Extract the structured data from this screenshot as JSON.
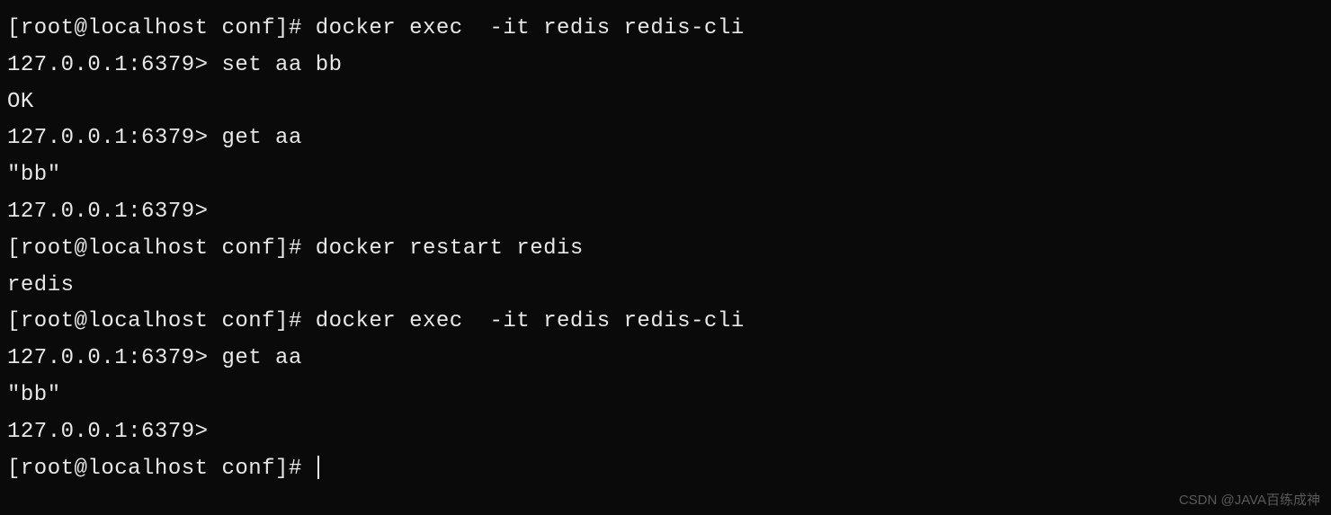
{
  "lines": [
    {
      "prompt": "[root@localhost conf]# ",
      "command": "docker exec  -it redis redis-cli"
    },
    {
      "prompt": "127.0.0.1:6379> ",
      "command": "set aa bb"
    },
    {
      "output": "OK"
    },
    {
      "prompt": "127.0.0.1:6379> ",
      "command": "get aa"
    },
    {
      "output": "\"bb\""
    },
    {
      "prompt": "127.0.0.1:6379> ",
      "command": ""
    },
    {
      "prompt": "[root@localhost conf]# ",
      "command": "docker restart redis"
    },
    {
      "output": "redis"
    },
    {
      "prompt": "[root@localhost conf]# ",
      "command": "docker exec  -it redis redis-cli"
    },
    {
      "prompt": "127.0.0.1:6379> ",
      "command": "get aa"
    },
    {
      "output": "\"bb\""
    },
    {
      "prompt": "127.0.0.1:6379> ",
      "command": ""
    },
    {
      "prompt": "[root@localhost conf]# ",
      "command": "",
      "cursor": true
    }
  ],
  "watermark": "CSDN @JAVA百练成神"
}
